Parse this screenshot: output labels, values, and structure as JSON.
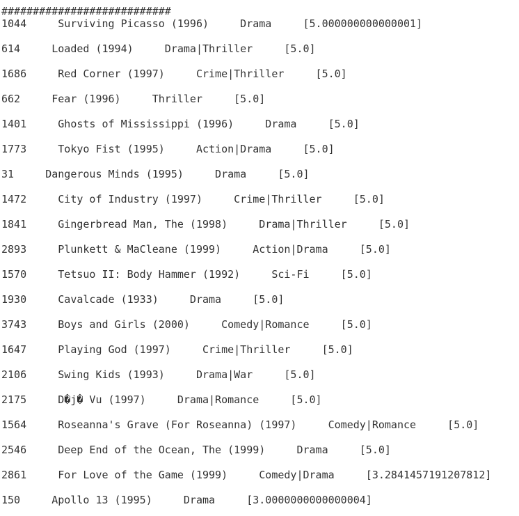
{
  "header": "###########################",
  "rows": [
    "1044     Surviving Picasso (1996)     Drama     [5.000000000000001]",
    "614     Loaded (1994)     Drama|Thriller     [5.0]",
    "1686     Red Corner (1997)     Crime|Thriller     [5.0]",
    "662     Fear (1996)     Thriller     [5.0]",
    "1401     Ghosts of Mississippi (1996)     Drama     [5.0]",
    "1773     Tokyo Fist (1995)     Action|Drama     [5.0]",
    "31     Dangerous Minds (1995)     Drama     [5.0]",
    "1472     City of Industry (1997)     Crime|Thriller     [5.0]",
    "1841     Gingerbread Man, The (1998)     Drama|Thriller     [5.0]",
    "2893     Plunkett & MaCleane (1999)     Action|Drama     [5.0]",
    "1570     Tetsuo II: Body Hammer (1992)     Sci-Fi     [5.0]",
    "1930     Cavalcade (1933)     Drama     [5.0]",
    "3743     Boys and Girls (2000)     Comedy|Romance     [5.0]",
    "1647     Playing God (1997)     Crime|Thriller     [5.0]",
    "2106     Swing Kids (1993)     Drama|War     [5.0]",
    "2175     D�j� Vu (1997)     Drama|Romance     [5.0]",
    "1564     Roseanna's Grave (For Roseanna) (1997)     Comedy|Romance     [5.0]",
    "2546     Deep End of the Ocean, The (1999)     Drama     [5.0]",
    "2861     For Love of the Game (1999)     Comedy|Drama     [3.2841457191207812]",
    "150     Apollo 13 (1995)     Drama     [3.0000000000000004]"
  ]
}
